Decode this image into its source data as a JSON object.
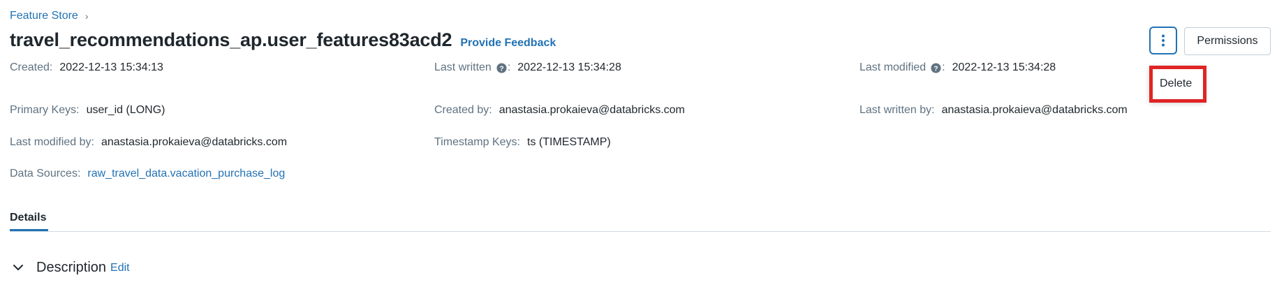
{
  "breadcrumb": {
    "root": "Feature Store",
    "separator": "›"
  },
  "header": {
    "title": "travel_recommendations_ap.user_features83acd2",
    "feedback_link": "Provide Feedback",
    "permissions_button": "Permissions"
  },
  "menu": {
    "items": [
      {
        "label": "Delete"
      }
    ]
  },
  "metadata": {
    "created": {
      "label": "Created:",
      "value": "2022-12-13 15:34:13"
    },
    "last_written": {
      "label": "Last written",
      "value": "2022-12-13 15:34:28"
    },
    "last_modified": {
      "label": "Last modified",
      "value": "2022-12-13 15:34:28"
    },
    "primary_keys": {
      "label": "Primary Keys:",
      "value": "user_id (LONG)"
    },
    "created_by": {
      "label": "Created by:",
      "value": "anastasia.prokaieva@databricks.com"
    },
    "last_written_by": {
      "label": "Last written by:",
      "value": "anastasia.prokaieva@databricks.com"
    },
    "last_modified_by": {
      "label": "Last modified by:",
      "value": "anastasia.prokaieva@databricks.com"
    },
    "timestamp_keys": {
      "label": "Timestamp Keys:",
      "value": "ts (TIMESTAMP)"
    },
    "data_sources": {
      "label": "Data Sources:",
      "value": "raw_travel_data.vacation_purchase_log"
    }
  },
  "tabs": [
    {
      "label": "Details",
      "active": true
    }
  ],
  "description": {
    "title": "Description",
    "edit_label": "Edit"
  },
  "colors": {
    "link": "#2272b4",
    "highlight": "#e02424",
    "muted": "#5f7281"
  },
  "icons": {
    "help": "question-circle-icon",
    "more": "kebab-vertical-icon",
    "chevron": "chevron-down-icon"
  }
}
